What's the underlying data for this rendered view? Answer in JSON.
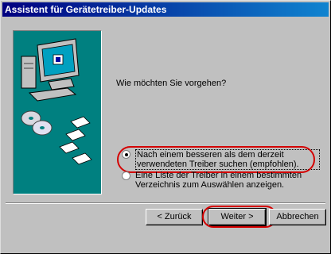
{
  "window": {
    "title": "Assistent für Gerätetreiber-Updates"
  },
  "main": {
    "question": "Wie möchten Sie vorgehen?",
    "options": [
      {
        "label": "Nach einem besseren als dem derzeit verwendeten Treiber suchen (empfohlen).",
        "checked": true
      },
      {
        "label": "Eine Liste der Treiber in einem bestimmten Verzeichnis zum Auswählen anzeigen.",
        "checked": false
      }
    ]
  },
  "buttons": {
    "back": "< Zurück",
    "next": "Weiter >",
    "cancel": "Abbrechen"
  },
  "colors": {
    "titlebar_start": "#000080",
    "art_background": "#008080",
    "highlight": "#d40000"
  }
}
